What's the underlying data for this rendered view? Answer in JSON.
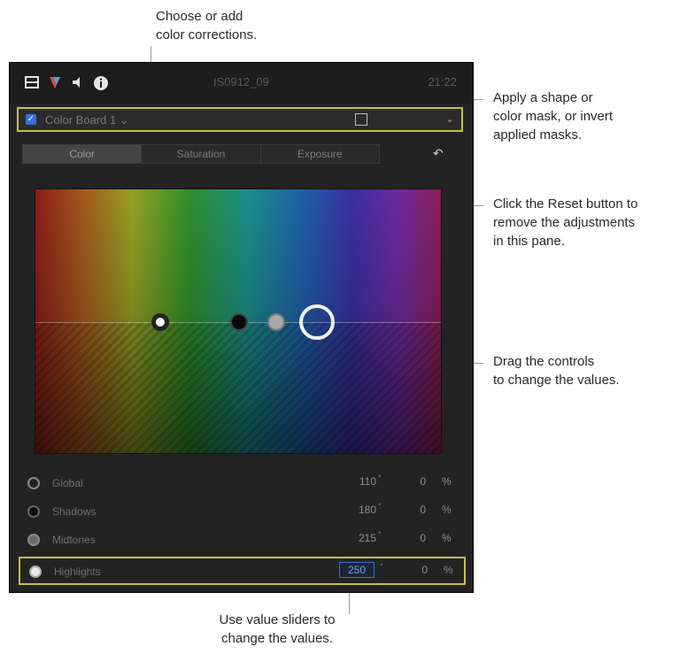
{
  "callouts": {
    "top": [
      "Choose or add",
      "color corrections."
    ],
    "mask": [
      "Apply a shape or",
      "color mask, or invert",
      "applied masks."
    ],
    "reset": [
      "Click the Reset button to",
      "remove the adjustments",
      "in this pane."
    ],
    "drag": [
      "Drag the controls",
      "to change the values."
    ],
    "sliders": [
      "Use value sliders to",
      "change the values."
    ]
  },
  "toolbar": {
    "icons": [
      "film-icon",
      "color-inspector-icon",
      "audio-icon",
      "info-icon"
    ],
    "clip_name": "IS0912_09",
    "duration": "21:22"
  },
  "board_row": {
    "enabled": true,
    "selected": "Color Board 1"
  },
  "tabs": [
    {
      "label": "Color",
      "active": true
    },
    {
      "label": "Saturation",
      "active": false
    },
    {
      "label": "Exposure",
      "active": false
    }
  ],
  "values": [
    {
      "label": "Global",
      "angle": "110",
      "percent": "0",
      "unit": "%"
    },
    {
      "label": "Shadows",
      "angle": "180",
      "percent": "0",
      "unit": "%"
    },
    {
      "label": "Midtones",
      "angle": "215",
      "percent": "0",
      "unit": "%"
    },
    {
      "label": "Highlights",
      "angle": "250",
      "percent": "0",
      "unit": "%"
    }
  ],
  "colors": {
    "highlight_border": "#c5c23a",
    "field_accent": "#3f6fd6"
  }
}
